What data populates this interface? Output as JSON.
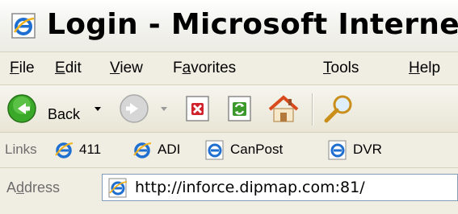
{
  "window": {
    "title": "Login - Microsoft Internet Ex"
  },
  "menu": {
    "items": [
      {
        "label": "File",
        "accel": "F",
        "rest": "ile"
      },
      {
        "label": "Edit",
        "accel": "E",
        "rest": "dit"
      },
      {
        "label": "View",
        "accel": "V",
        "rest": "iew"
      },
      {
        "label": "Favorites",
        "pre": "F",
        "accel": "a",
        "rest": "vorites"
      },
      {
        "label": "Tools",
        "accel": "T",
        "rest": "ools"
      },
      {
        "label": "Help",
        "accel": "H",
        "rest": "elp"
      }
    ]
  },
  "toolbar": {
    "back_label": "Back",
    "icons": [
      "back-icon",
      "forward-icon",
      "stop-icon",
      "refresh-icon",
      "home-icon",
      "search-icon"
    ]
  },
  "links": {
    "label": "Links",
    "items": [
      {
        "label": "411"
      },
      {
        "label": "ADI"
      },
      {
        "label": "CanPost"
      },
      {
        "label": "DVR"
      }
    ]
  },
  "address": {
    "label_pre": "A",
    "label_accel": "d",
    "label_rest": "dress",
    "url": "http://inforce.dipmap.com:81/"
  },
  "colors": {
    "chrome": "#ece9d8",
    "ie_blue": "#1f6fd0",
    "back_green": "#3aa829",
    "stop_red": "#d0232b",
    "refresh_green": "#3c9a2c"
  }
}
